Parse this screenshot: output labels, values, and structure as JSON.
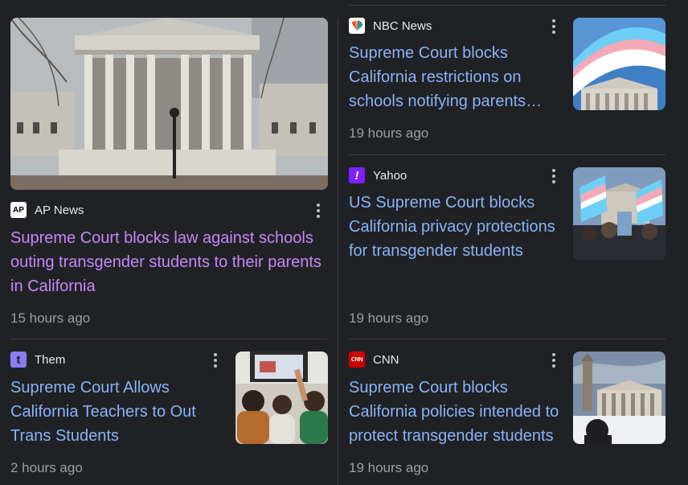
{
  "articles": [
    {
      "source": "AP News",
      "logo_text": "AP",
      "headline": "Supreme Court blocks law against schools outing transgender students to their parents in California",
      "time": "15 hours ago",
      "image": "supreme-court-building-photo"
    },
    {
      "source": "NBC News",
      "logo_text": "",
      "headline": "Supreme Court blocks California restrictions on schools notifying parents…",
      "time": "19 hours ago",
      "image": "transgender-flag-supreme-court-photo"
    },
    {
      "source": "Yahoo",
      "logo_text": "!",
      "headline": "US Supreme Court blocks California privacy protections for transgender students",
      "time": "19 hours ago",
      "image": "protest-transgender-flags-photo"
    },
    {
      "source": "Them",
      "logo_text": "t",
      "headline": "Supreme Court Allows California Teachers to Out Trans Students",
      "time": "2 hours ago",
      "image": "classroom-students-photo"
    },
    {
      "source": "CNN",
      "logo_text": "CNN",
      "headline": "Supreme Court blocks California policies intended to protect transgender students",
      "time": "19 hours ago",
      "image": "supreme-court-winter-photo"
    }
  ],
  "colors": {
    "background": "#202124",
    "headline_link": "#8ab4f8",
    "headline_visited": "#c58af9",
    "time_text": "#9aa0a6",
    "divider": "#3c4043"
  }
}
